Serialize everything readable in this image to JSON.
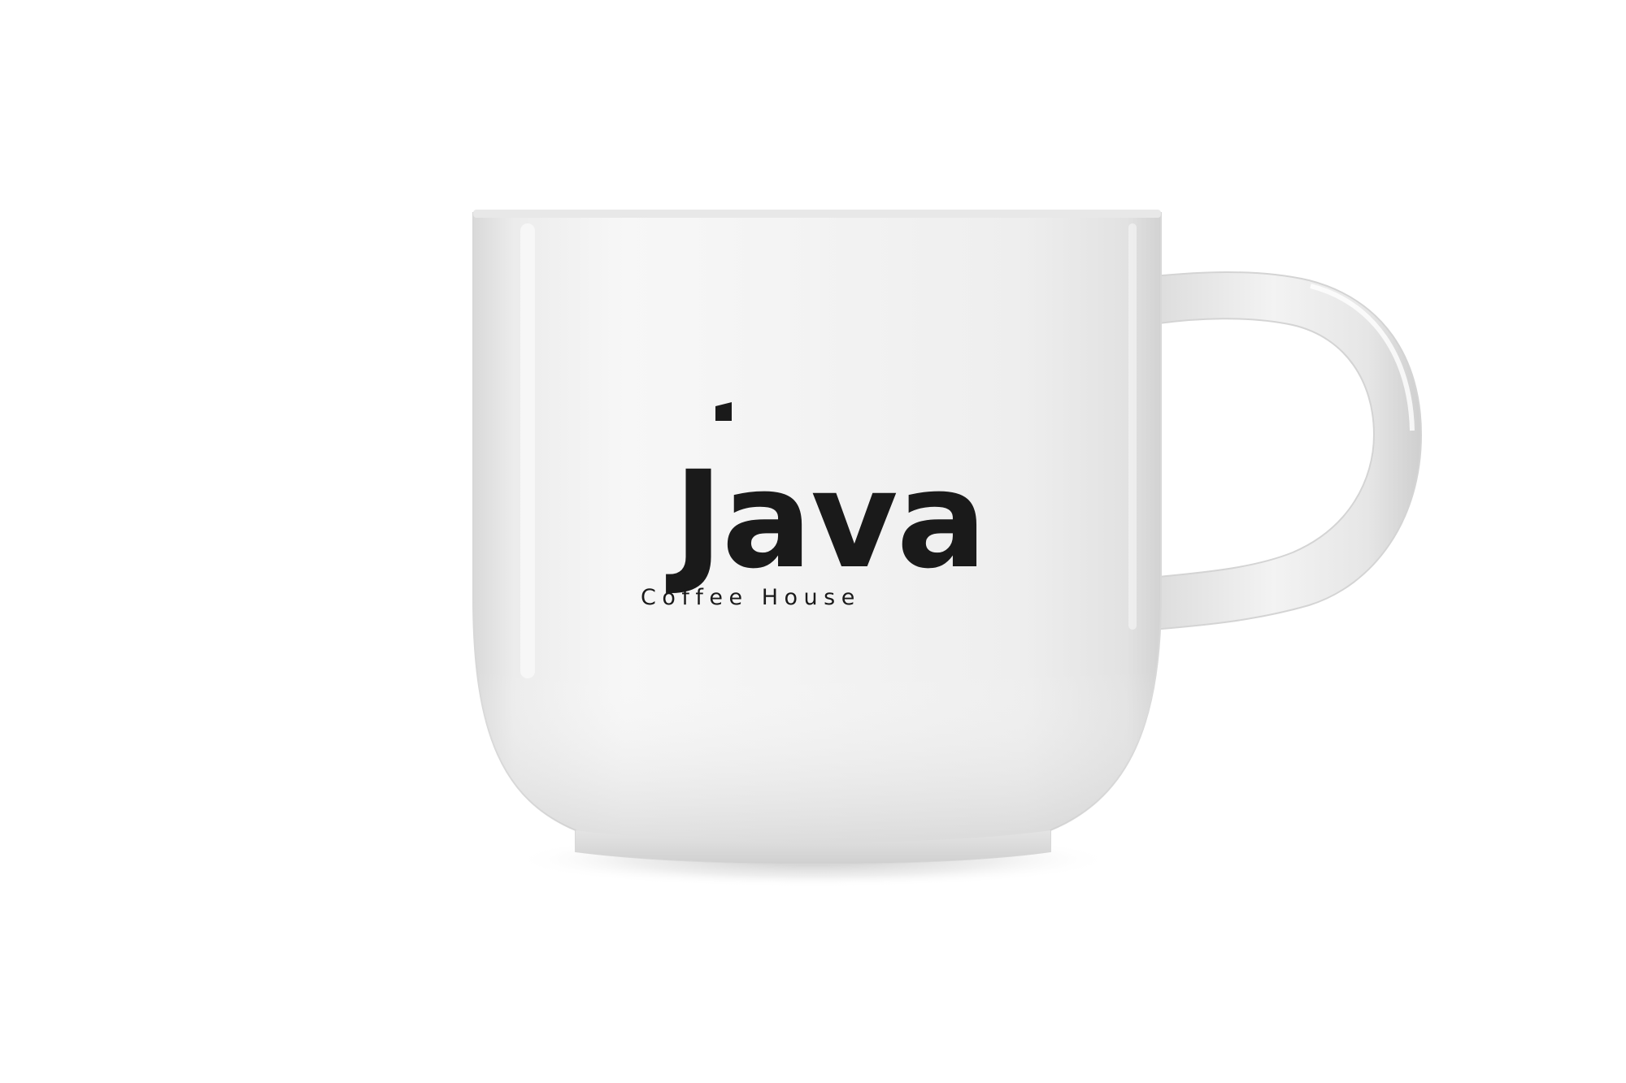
{
  "logo": {
    "wordmark": "Java",
    "tagline": "Coffee House"
  },
  "colors": {
    "background": "#ffffff",
    "mug": "#f2f2f2",
    "mug_shadow": "#cfcfcf",
    "logo_ink": "#1a1a1a"
  }
}
